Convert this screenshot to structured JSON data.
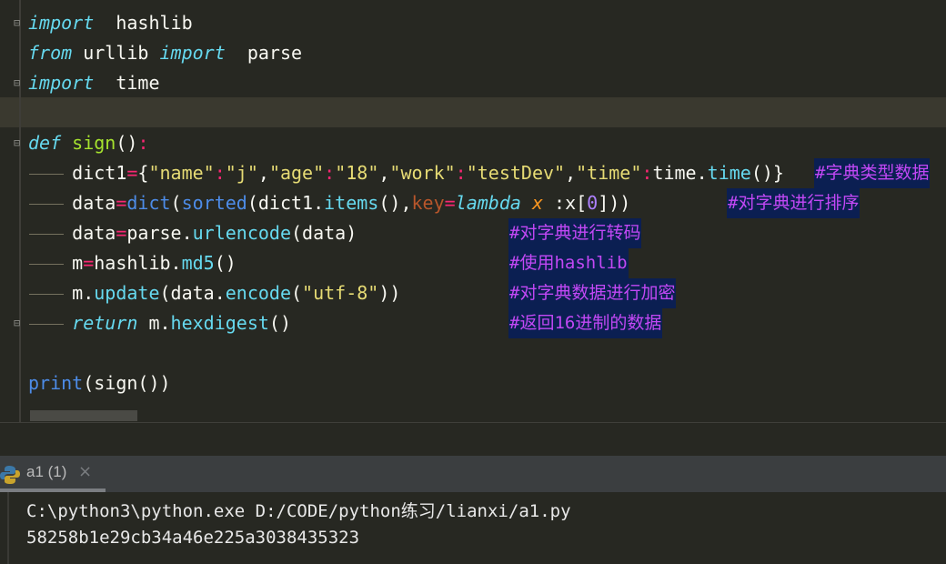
{
  "editor": {
    "lines": [
      {
        "tokens": [
          [
            "import",
            "kw"
          ],
          [
            "  hashlib",
            ""
          ]
        ]
      },
      {
        "tokens": [
          [
            "from",
            "kw"
          ],
          [
            " urllib ",
            ""
          ],
          [
            "import",
            "kw"
          ],
          [
            "  parse",
            ""
          ]
        ]
      },
      {
        "tokens": [
          [
            "import",
            "kw"
          ],
          [
            "  time",
            ""
          ]
        ]
      },
      {
        "tokens": []
      },
      {
        "tokens": [
          [
            "def",
            "kw"
          ],
          [
            " ",
            ""
          ],
          [
            "sign",
            "fn"
          ],
          [
            "()",
            ""
          ],
          [
            ":",
            "op"
          ]
        ]
      },
      {
        "tokens": [
          [
            "    dict1",
            ""
          ],
          [
            "=",
            "op"
          ],
          [
            "{",
            ""
          ],
          [
            "\"name\"",
            "str"
          ],
          [
            ":",
            "op"
          ],
          [
            "\"j\"",
            "str"
          ],
          [
            ",",
            ""
          ],
          [
            "\"age\"",
            "str"
          ],
          [
            ":",
            "op"
          ],
          [
            "\"18\"",
            "str"
          ],
          [
            ",",
            ""
          ],
          [
            "\"work\"",
            "str"
          ],
          [
            ":",
            "op"
          ],
          [
            "\"testDev\"",
            "str"
          ],
          [
            ",",
            ""
          ],
          [
            "\"time\"",
            "str"
          ],
          [
            ":",
            "op"
          ],
          [
            "time.",
            ""
          ],
          [
            "time",
            "me"
          ],
          [
            "()}",
            ""
          ]
        ],
        "comment": "#字典类型数据"
      },
      {
        "tokens": [
          [
            "    data",
            ""
          ],
          [
            "=",
            "op"
          ],
          [
            "dict",
            "bi"
          ],
          [
            "(",
            ""
          ],
          [
            "sorted",
            "bi"
          ],
          [
            "(dict1.",
            ""
          ],
          [
            "items",
            "me"
          ],
          [
            "(),",
            ""
          ],
          [
            "key",
            "kwarg"
          ],
          [
            "=",
            "op"
          ],
          [
            "lambda",
            "kw"
          ],
          [
            " ",
            ""
          ],
          [
            "x",
            "par"
          ],
          [
            " :x[",
            ""
          ],
          [
            "0",
            "num"
          ],
          [
            "]))",
            ""
          ]
        ],
        "comment": "#对字典进行排序"
      },
      {
        "tokens": [
          [
            "    data",
            ""
          ],
          [
            "=",
            "op"
          ],
          [
            "parse.",
            ""
          ],
          [
            "urlencode",
            "me"
          ],
          [
            "(data)",
            ""
          ]
        ],
        "comment": "#对字典进行转码"
      },
      {
        "tokens": [
          [
            "    m",
            ""
          ],
          [
            "=",
            "op"
          ],
          [
            "hashlib.",
            ""
          ],
          [
            "md5",
            "me"
          ],
          [
            "()",
            ""
          ]
        ],
        "comment": "#使用hashlib"
      },
      {
        "tokens": [
          [
            "    m.",
            ""
          ],
          [
            "update",
            "me"
          ],
          [
            "(data.",
            ""
          ],
          [
            "encode",
            "me"
          ],
          [
            "(",
            ""
          ],
          [
            "\"utf-8\"",
            "str"
          ],
          [
            "))",
            ""
          ]
        ],
        "comment": "#对字典数据进行加密"
      },
      {
        "tokens": [
          [
            "    ",
            ""
          ],
          [
            "return",
            "kw"
          ],
          [
            " m.",
            ""
          ],
          [
            "hexdigest",
            "me"
          ],
          [
            "()",
            ""
          ]
        ],
        "comment": "#返回16进制的数据"
      },
      {
        "tokens": []
      },
      {
        "tokens": [
          [
            "print",
            "bi"
          ],
          [
            "(sign())",
            ""
          ]
        ]
      }
    ]
  },
  "run_tab": {
    "label": "a1 (1)",
    "close": "×",
    "icon": "python-icon"
  },
  "console": {
    "lines": [
      "C:\\python3\\python.exe D:/CODE/python练习/lianxi/a1.py",
      "58258b1e29cb34a46e225a3038435323"
    ]
  },
  "colors": {
    "background": "#272822",
    "comment_bg": "#0b1f52",
    "comment_fg": "#c248f5",
    "keyword": "#66d9ef",
    "string": "#e6db74",
    "operator": "#f92672"
  }
}
